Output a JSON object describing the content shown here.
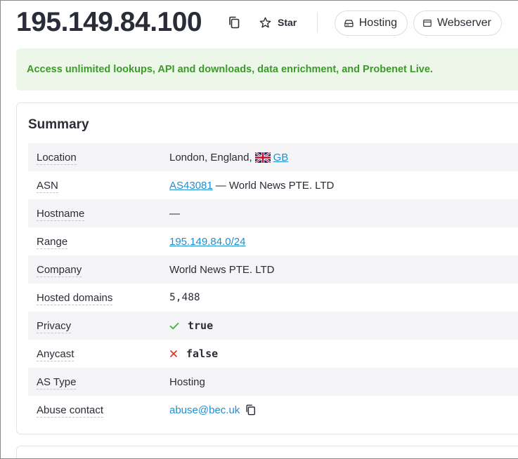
{
  "header": {
    "ip": "195.149.84.100",
    "star_label": "Star",
    "tags": [
      "Hosting",
      "Webserver"
    ]
  },
  "banner": {
    "text": "Access unlimited lookups, API and downloads, data enrichment, and Probenet Live."
  },
  "summary": {
    "title": "Summary",
    "location": {
      "label": "Location",
      "text": "London, England,",
      "country_code": "GB"
    },
    "asn": {
      "label": "ASN",
      "asn": "AS43081",
      "org": "— World News PTE. LTD"
    },
    "hostname": {
      "label": "Hostname",
      "value": "—"
    },
    "range": {
      "label": "Range",
      "value": "195.149.84.0/24"
    },
    "company": {
      "label": "Company",
      "value": "World News PTE. LTD"
    },
    "hosted_domains": {
      "label": "Hosted domains",
      "value": "5,488"
    },
    "privacy": {
      "label": "Privacy",
      "value": "true"
    },
    "anycast": {
      "label": "Anycast",
      "value": "false"
    },
    "as_type": {
      "label": "AS Type",
      "value": "Hosting"
    },
    "abuse": {
      "label": "Abuse contact",
      "value": "abuse@bec.uk"
    }
  },
  "colors": {
    "banner_bg": "#ecf7ea",
    "banner_text": "#3d9a2a",
    "link": "#1f8fd1",
    "check": "#3db33d",
    "cross": "#e03131"
  }
}
